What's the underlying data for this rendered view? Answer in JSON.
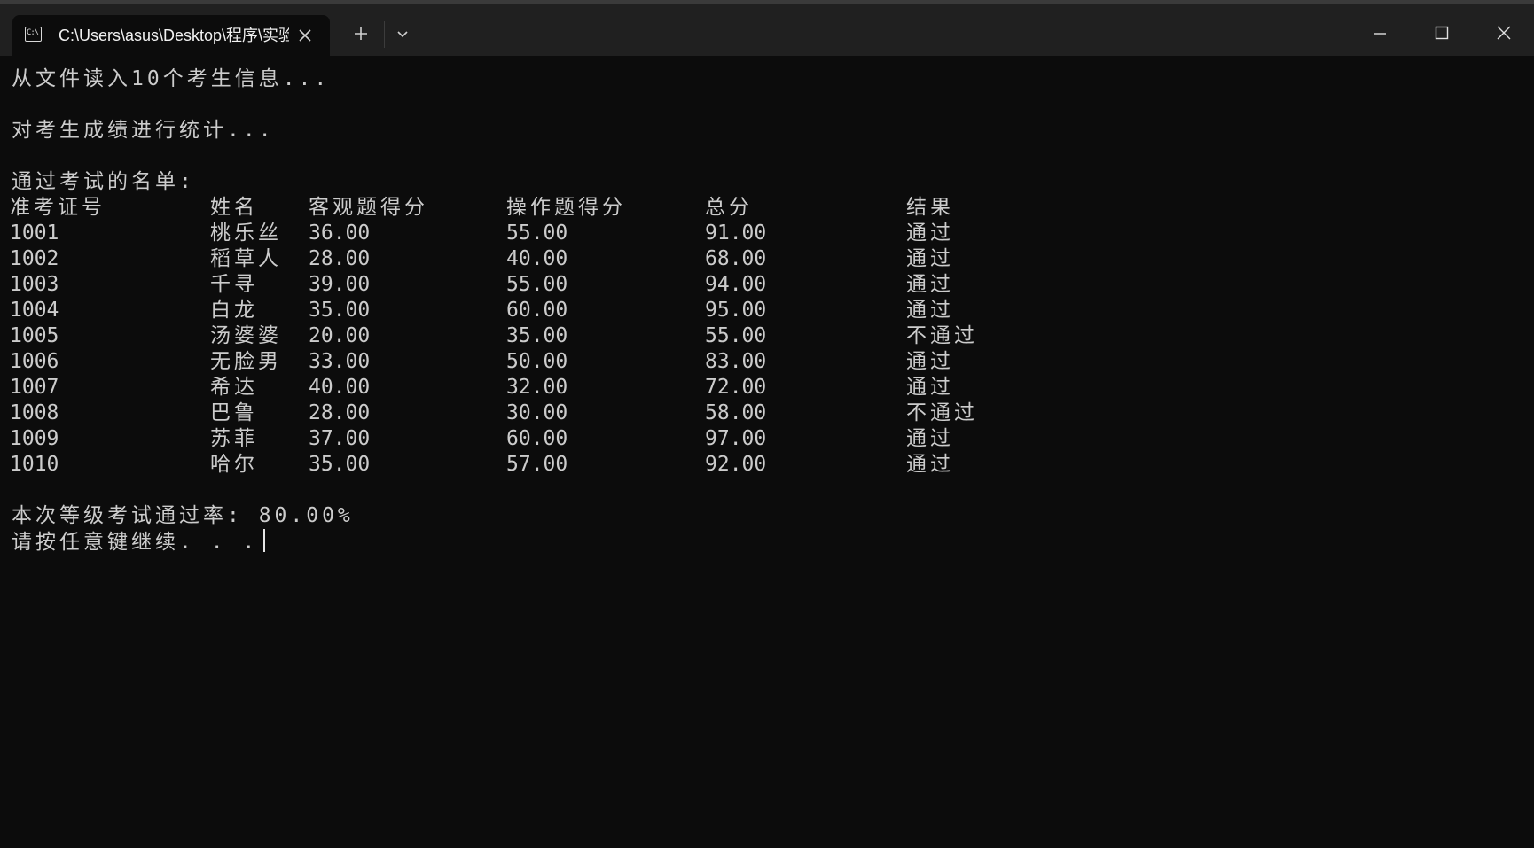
{
  "window": {
    "tab_title": "C:\\Users\\asus\\Desktop\\程序\\实验",
    "tab_icon": "console-icon",
    "colors": {
      "background": "#0c0c0c",
      "titlebar": "#202020",
      "text": "#cccccc"
    }
  },
  "console": {
    "line_read": "从文件读入10个考生信息...",
    "line_stats": "对考生成绩进行统计...",
    "line_pass_list": "通过考试的名单:",
    "headers": [
      "准考证号",
      "姓名",
      "客观题得分",
      "操作题得分",
      "总分",
      "结果"
    ],
    "rows": [
      [
        "1001",
        "桃乐丝",
        "36.00",
        "55.00",
        "91.00",
        "通过"
      ],
      [
        "1002",
        "稻草人",
        "28.00",
        "40.00",
        "68.00",
        "通过"
      ],
      [
        "1003",
        "千寻",
        "39.00",
        "55.00",
        "94.00",
        "通过"
      ],
      [
        "1004",
        "白龙",
        "35.00",
        "60.00",
        "95.00",
        "通过"
      ],
      [
        "1005",
        "汤婆婆",
        "20.00",
        "35.00",
        "55.00",
        "不通过"
      ],
      [
        "1006",
        "无脸男",
        "33.00",
        "50.00",
        "83.00",
        "通过"
      ],
      [
        "1007",
        "希达",
        "40.00",
        "32.00",
        "72.00",
        "通过"
      ],
      [
        "1008",
        "巴鲁",
        "28.00",
        "30.00",
        "58.00",
        "不通过"
      ],
      [
        "1009",
        "苏菲",
        "37.00",
        "60.00",
        "97.00",
        "通过"
      ],
      [
        "1010",
        "哈尔",
        "35.00",
        "57.00",
        "92.00",
        "通过"
      ]
    ],
    "pass_rate_line": "本次等级考试通过率: 80.00%",
    "prompt_line": "请按任意键继续. . ."
  }
}
